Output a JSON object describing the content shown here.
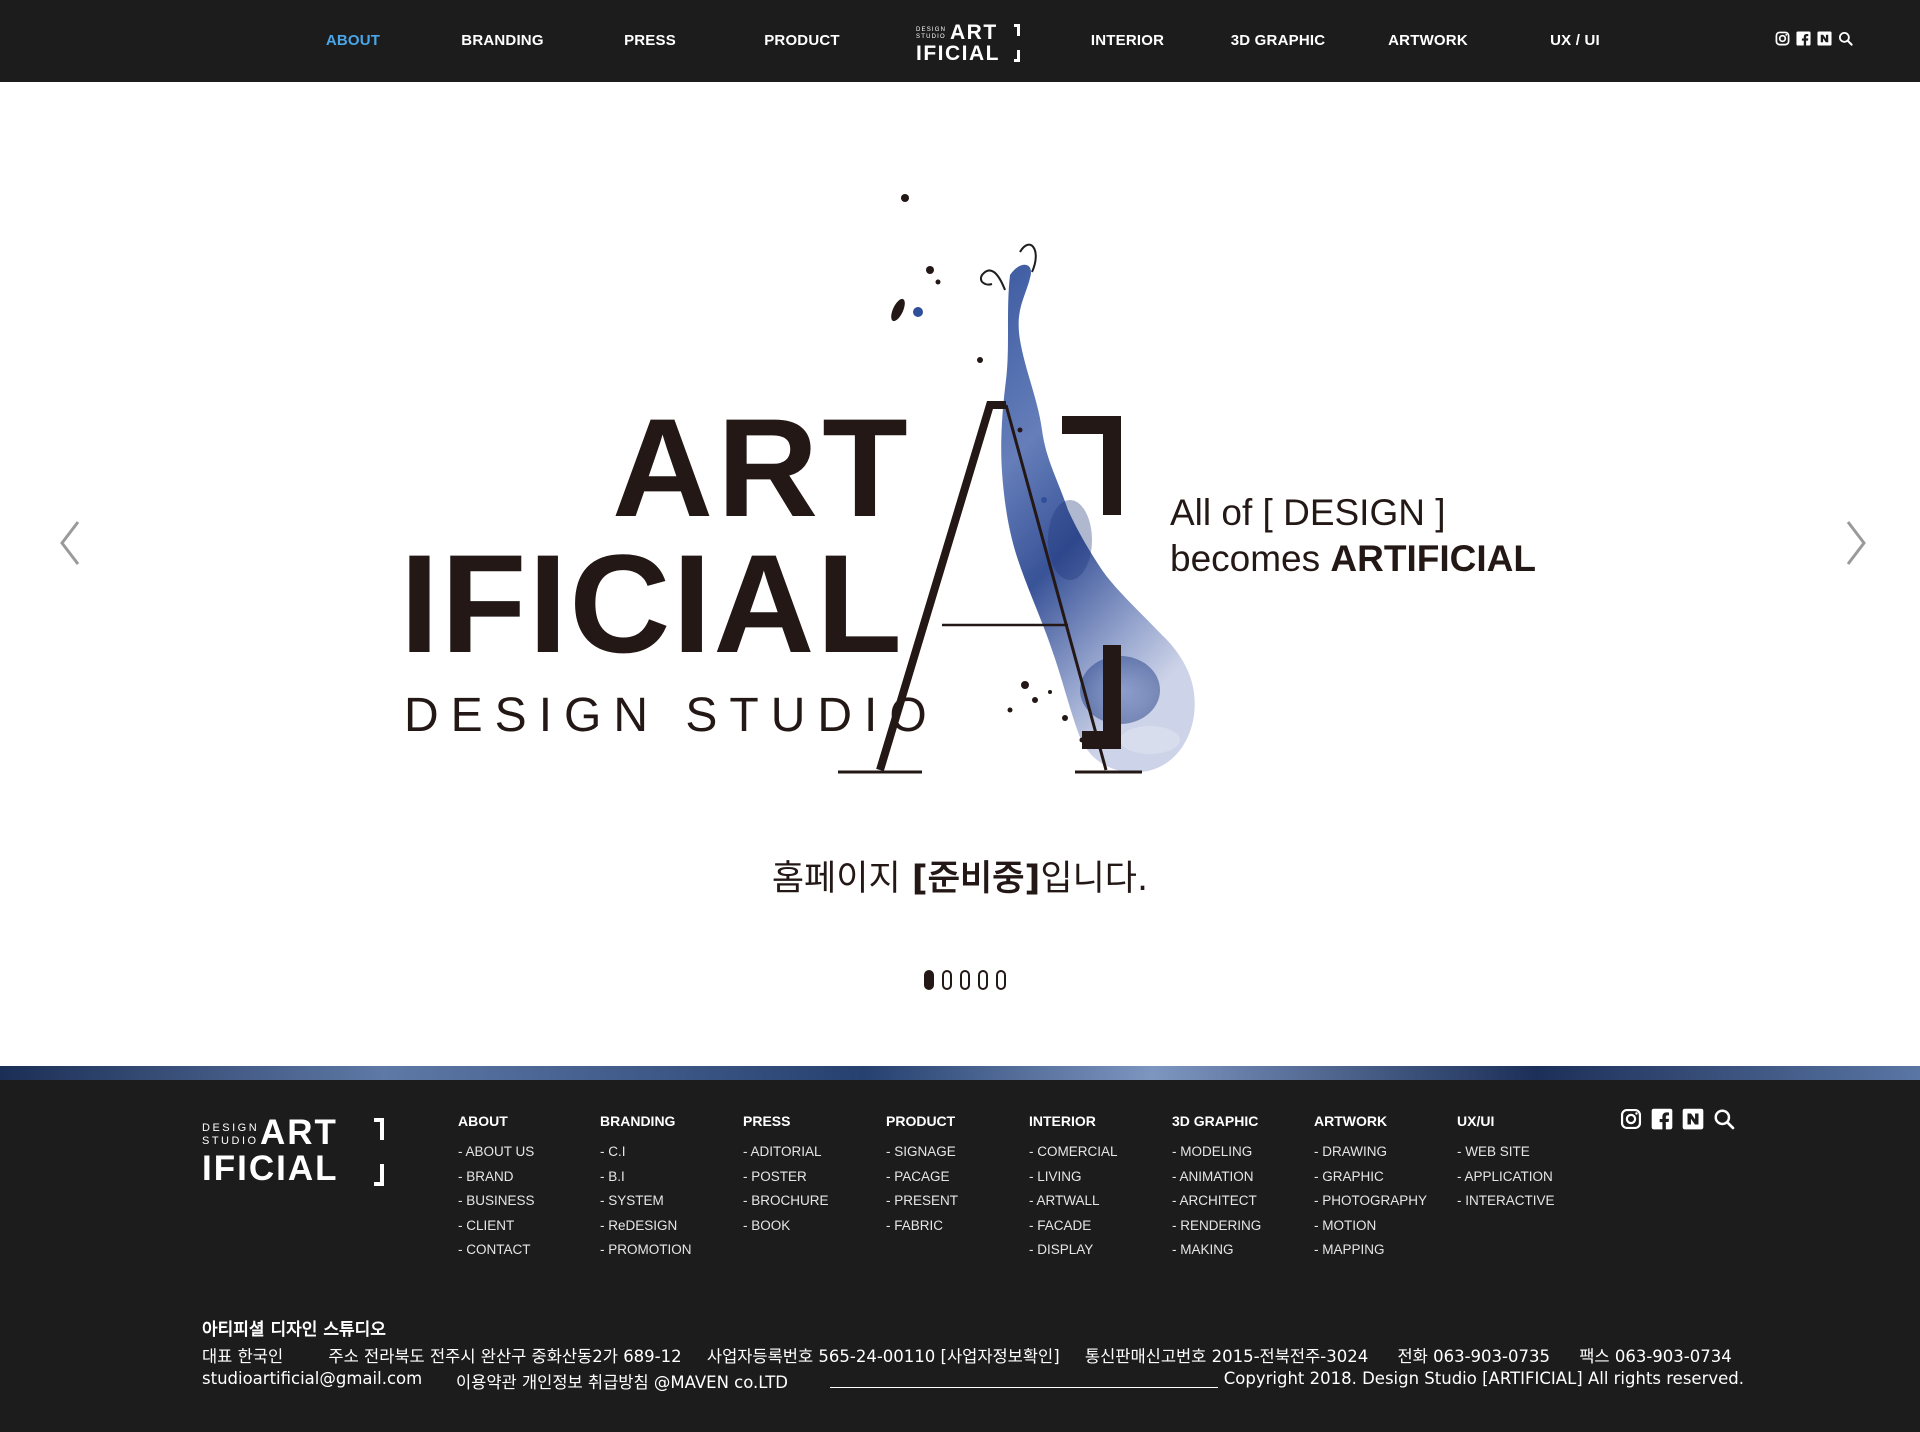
{
  "nav": {
    "items": [
      "ABOUT",
      "BRANDING",
      "PRESS",
      "PRODUCT",
      "INTERIOR",
      "3D GRAPHIC",
      "ARTWORK",
      "UX / UI"
    ],
    "active": "ABOUT",
    "active_color": "#4aa6e8"
  },
  "logo": {
    "small_line1": "DESIGN",
    "small_line2": "STUDIO",
    "word1": "ART",
    "word2": "IFICIAL"
  },
  "social_icons": [
    "instagram-icon",
    "facebook-icon",
    "naver-icon",
    "search-icon"
  ],
  "hero": {
    "word1": "ART",
    "word2": "IFICIAL",
    "subtitle": "DESIGN STUDIO",
    "tagline_line1": "All of [ DESIGN ]",
    "tagline_line2_prefix": "becomes ",
    "tagline_line2_bold": "ARTIFICIAL",
    "notice_prefix": "홈페이지 ",
    "notice_bold": "[준비중]",
    "notice_suffix": "입니다.",
    "slide_count": 5,
    "active_slide": 1,
    "accent_color": "#3b5ea8"
  },
  "footer": {
    "logo_small1": "DESIGN",
    "logo_small2": "STUDIO",
    "logo_word1": "ART",
    "logo_word2": "IFICIAL",
    "columns": [
      {
        "heading": "ABOUT",
        "items": [
          "- ABOUT US",
          "- BRAND",
          "- BUSINESS",
          "- CLIENT",
          "- CONTACT"
        ]
      },
      {
        "heading": "BRANDING",
        "items": [
          "- C.I",
          "- B.I",
          "- SYSTEM",
          "- ReDESIGN",
          "- PROMOTION"
        ]
      },
      {
        "heading": "PRESS",
        "items": [
          "- ADITORIAL",
          "- POSTER",
          "- BROCHURE",
          "- BOOK"
        ]
      },
      {
        "heading": "PRODUCT",
        "items": [
          "- SIGNAGE",
          "- PACAGE",
          "- PRESENT",
          "- FABRIC"
        ]
      },
      {
        "heading": "INTERIOR",
        "items": [
          "- COMERCIAL",
          "- LIVING",
          "- ARTWALL",
          "- FACADE",
          "- DISPLAY"
        ]
      },
      {
        "heading": "3D GRAPHIC",
        "items": [
          "- MODELING",
          "- ANIMATION",
          "- ARCHITECT",
          "- RENDERING",
          "- MAKING"
        ]
      },
      {
        "heading": "ARTWORK",
        "items": [
          "- DRAWING",
          "- GRAPHIC",
          "- PHOTOGRAPHY",
          "- MOTION",
          "- MAPPING"
        ]
      },
      {
        "heading": "UX/UI",
        "items": [
          "- WEB SITE",
          "- APPLICATION",
          "- INTERACTIVE"
        ]
      }
    ],
    "company": "아티피셜 디자인 스튜디오",
    "ceo": "대표 한국인",
    "address": "주소 전라북도 전주시 완산구 중화산동2가 689-12",
    "business_no": "사업자등록번호 565-24-00110 [사업자정보확인]",
    "mail_order_no": "통신판매신고번호 2015-전북전주-3024",
    "phone": "전화 063-903-0735",
    "fax": "팩스 063-903-0734",
    "email": "studioartificial@gmail.com",
    "policy": "이용약관 개인정보 취급방침 @MAVEN co.LTD",
    "copyright": "Copyright 2018. Design Studio [ARTIFICIAL] All rights reserved."
  }
}
